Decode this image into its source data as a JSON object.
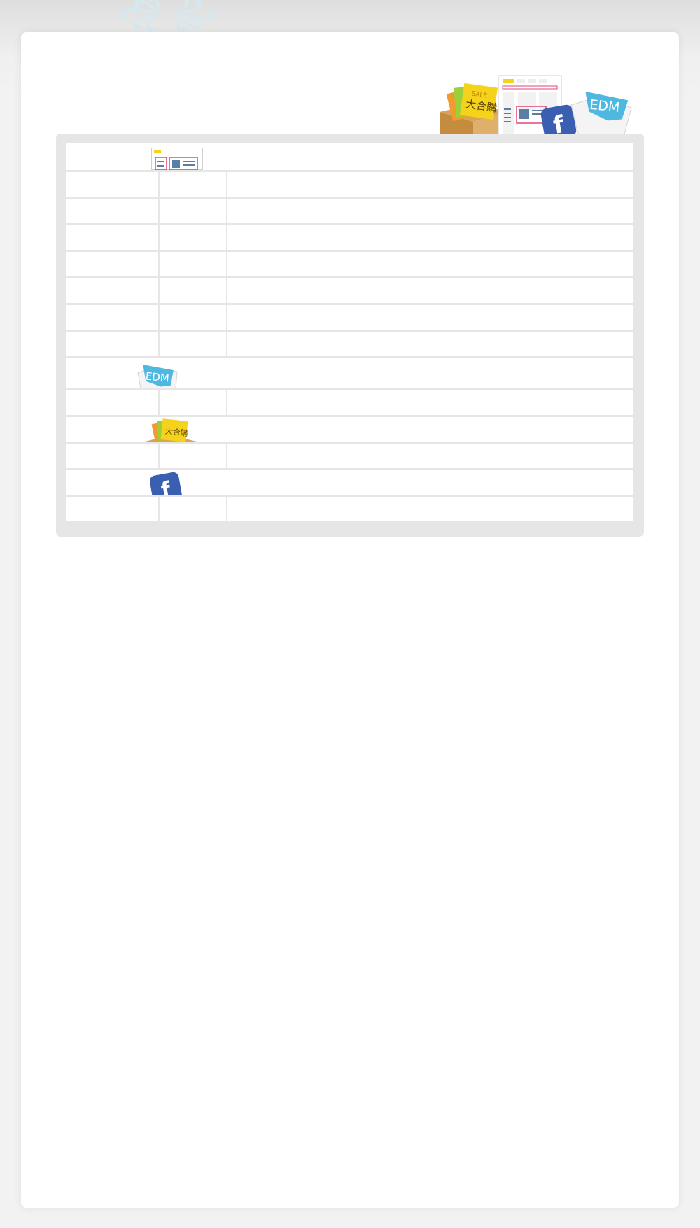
{
  "header": {
    "logo_icon": "site-logo-icon"
  },
  "hero": {
    "icons": [
      "sale-box-icon",
      "newspaper-icon",
      "facebook-icon",
      "edm-envelope-icon"
    ],
    "sale_label": "SALE",
    "sale_text": "大合購",
    "edm_label": "EDM"
  },
  "table": {
    "sections": [
      {
        "icon": "newspaper-icon",
        "rows": [
          {
            "col1": "",
            "col2": "",
            "col3": ""
          },
          {
            "col1": "",
            "col2": "",
            "col3": ""
          },
          {
            "col1": "",
            "col2": "",
            "col3": ""
          },
          {
            "col1": "",
            "col2": "",
            "col3": ""
          },
          {
            "col1": "",
            "col2": "",
            "col3": ""
          },
          {
            "col1": "",
            "col2": "",
            "col3": ""
          },
          {
            "col1": "",
            "col2": "",
            "col3": ""
          }
        ]
      },
      {
        "icon": "edm-envelope-icon",
        "label": "EDM",
        "rows": [
          {
            "col1": "",
            "col2": "",
            "col3": ""
          }
        ]
      },
      {
        "icon": "sale-box-icon",
        "label": "大合購",
        "rows": [
          {
            "col1": "",
            "col2": "",
            "col3": ""
          }
        ]
      },
      {
        "icon": "facebook-icon",
        "rows": [
          {
            "col1": "",
            "col2": "",
            "col3": ""
          }
        ]
      }
    ]
  },
  "colors": {
    "background": "#f2f2f2",
    "card": "#ffffff",
    "panel": "#e6e6e6",
    "edm_blue": "#4fb8e0",
    "facebook_blue": "#3b5fb0",
    "sale_yellow": "#f5d21c",
    "accent_pink": "#e0457b"
  }
}
